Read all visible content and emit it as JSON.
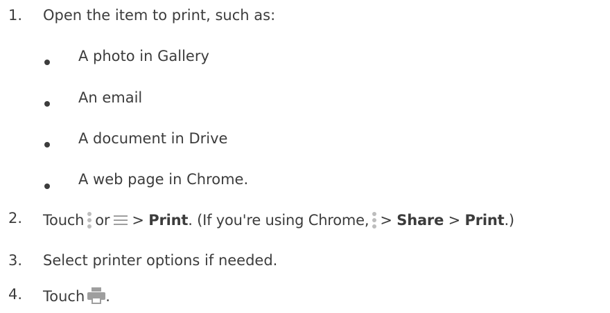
{
  "steps": [
    {
      "number": "1.",
      "text": "Open the item to print, such as:"
    },
    {
      "number": "2."
    },
    {
      "number": "3.",
      "text": "Select printer options if needed."
    },
    {
      "number": "4.",
      "text": "Touch",
      "suffix": "."
    }
  ],
  "sub_items": [
    "A photo in Gallery",
    "An email",
    "A document in Drive",
    "A web page in Chrome."
  ],
  "step2": {
    "touch": "Touch",
    "or": "or",
    "gt1": ">",
    "print1": "Print",
    "mid": ". (If you're using Chrome,",
    "gt2": ">",
    "share": "Share",
    "gt3": ">",
    "print2": "Print",
    "end": ".)"
  },
  "icons": {
    "more_vert": "more-vert-icon",
    "menu": "menu-icon",
    "print": "print-icon"
  },
  "colors": {
    "text": "#3c3c3c",
    "icon_gray": "#bdbdbd",
    "print_icon": "#9e9e9e"
  }
}
